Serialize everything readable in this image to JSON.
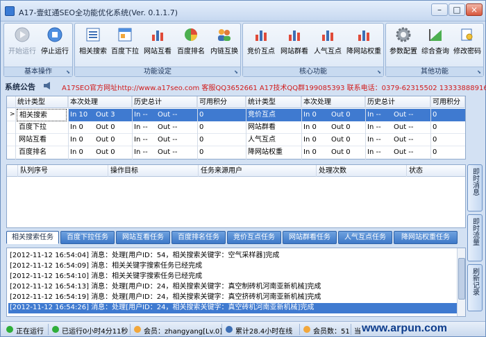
{
  "window": {
    "title": "A17-壹虹通SEO全功能优化系统(Ver. 0.1.1.7)",
    "minimize": "–",
    "maximize": "□",
    "close": "×"
  },
  "ribbon": {
    "groups": [
      {
        "label": "基本操作",
        "tools": [
          {
            "label": "开始运行",
            "icon": "play-icon"
          },
          {
            "label": "停止运行",
            "icon": "stop-icon"
          }
        ]
      },
      {
        "label": "功能设定",
        "tools": [
          {
            "label": "相关搜索",
            "icon": "list-icon"
          },
          {
            "label": "百度下拉",
            "icon": "dropdown-window-icon"
          },
          {
            "label": "网站互看",
            "icon": "bar-chart-icon"
          },
          {
            "label": "百度排名",
            "icon": "pie-chart-icon"
          },
          {
            "label": "内链互换",
            "icon": "users-icon"
          }
        ]
      },
      {
        "label": "核心功能",
        "tools": [
          {
            "label": "竞价互点",
            "icon": "bar-chart-icon"
          },
          {
            "label": "网站群看",
            "icon": "bar-chart-icon"
          },
          {
            "label": "人气互点",
            "icon": "bar-chart-icon"
          },
          {
            "label": "降网站权重",
            "icon": "bar-chart-icon"
          }
        ]
      },
      {
        "label": "其他功能",
        "tools": [
          {
            "label": "参数配置",
            "icon": "gear-icon"
          },
          {
            "label": "综合查询",
            "icon": "trend-chart-icon"
          },
          {
            "label": "修改密码",
            "icon": "key-icon"
          }
        ]
      }
    ]
  },
  "notice": {
    "label": "系统公告",
    "text": "A17SEO官方网址http://www.a17seo.com 客服QQ3652661 A17技术QQ群199085393 联系电话：0379-62315502 13333888916"
  },
  "stats": {
    "headers": [
      "统计类型",
      "本次处理",
      "历史总计",
      "可用积分",
      "统计类型",
      "本次处理",
      "历史总计",
      "可用积分"
    ],
    "rows": [
      {
        "t1": "相关搜索",
        "cur1_in": "In 10",
        "cur1_out": "Out 3",
        "his1_in": "In --",
        "his1_out": "Out --",
        "pts1": "0",
        "t2": "竞价互点",
        "cur2_in": "In 0",
        "cur2_out": "Out 0",
        "his2_in": "In --",
        "his2_out": "Out --",
        "pts2": "0"
      },
      {
        "t1": "百度下拉",
        "cur1_in": "In 0",
        "cur1_out": "Out 0",
        "his1_in": "In --",
        "his1_out": "Out --",
        "pts1": "0",
        "t2": "网站群看",
        "cur2_in": "In 0",
        "cur2_out": "Out 0",
        "his2_in": "In --",
        "his2_out": "Out --",
        "pts2": "0"
      },
      {
        "t1": "网站互看",
        "cur1_in": "In 0",
        "cur1_out": "Out 0",
        "his1_in": "In --",
        "his1_out": "Out --",
        "pts1": "0",
        "t2": "人气互点",
        "cur2_in": "In 0",
        "cur2_out": "Out 0",
        "his2_in": "In --",
        "his2_out": "Out --",
        "pts2": "0"
      },
      {
        "t1": "百度排名",
        "cur1_in": "In 0",
        "cur1_out": "Out 0",
        "his1_in": "In --",
        "his1_out": "Out --",
        "pts1": "0",
        "t2": "降网站权重",
        "cur2_in": "In 0",
        "cur2_out": "Out 0",
        "his2_in": "In --",
        "his2_out": "Out --",
        "pts2": "0"
      }
    ],
    "row_marker": ">"
  },
  "queue": {
    "headers": [
      "队列序号",
      "操作目标",
      "任务来源用户",
      "处理次数",
      "状态"
    ]
  },
  "tabs": [
    "相关搜索任务",
    "百度下拉任务",
    "网站互看任务",
    "百度排名任务",
    "竞价互点任务",
    "网站群看任务",
    "人气互点任务",
    "降网站权重任务"
  ],
  "side_tabs": [
    "即时消息",
    "即时流量",
    "刷新记录"
  ],
  "log": [
    "[2012-11-12 16:54:04] 消息：处理[用户ID：54，相关搜索关键字：空气采样器]完成",
    "[2012-11-12 16:54:09] 消息：相关关键字搜索任务已经完成",
    "[2012-11-12 16:54:10] 消息：相关关键字搜索任务已经完成",
    "[2012-11-12 16:54:13] 消息：处理[用户ID：24，相关搜索关键字：真空制砖机河南亚新机械]完成",
    "[2012-11-12 16:54:19] 消息：处理[用户ID：24，相关搜索关键字：真空挤砖机河南亚新机械]完成",
    "[2012-11-12 16:54:26] 消息：处理[用户ID：24，相关搜索关键字：真空砖机河南亚新机械]完成"
  ],
  "status": {
    "running": "正在运行",
    "elapsed": "已运行0小时4分11秒",
    "member": "会员：zhangyang[Lv.0]",
    "online": "累计28.4小时在线",
    "members": "会员数：51",
    "current": "当"
  },
  "watermark": "www.arpun.com",
  "colors": {
    "accent": "#3f7ad0",
    "notice": "#d21b1b",
    "status_green": "#2fae3a"
  }
}
